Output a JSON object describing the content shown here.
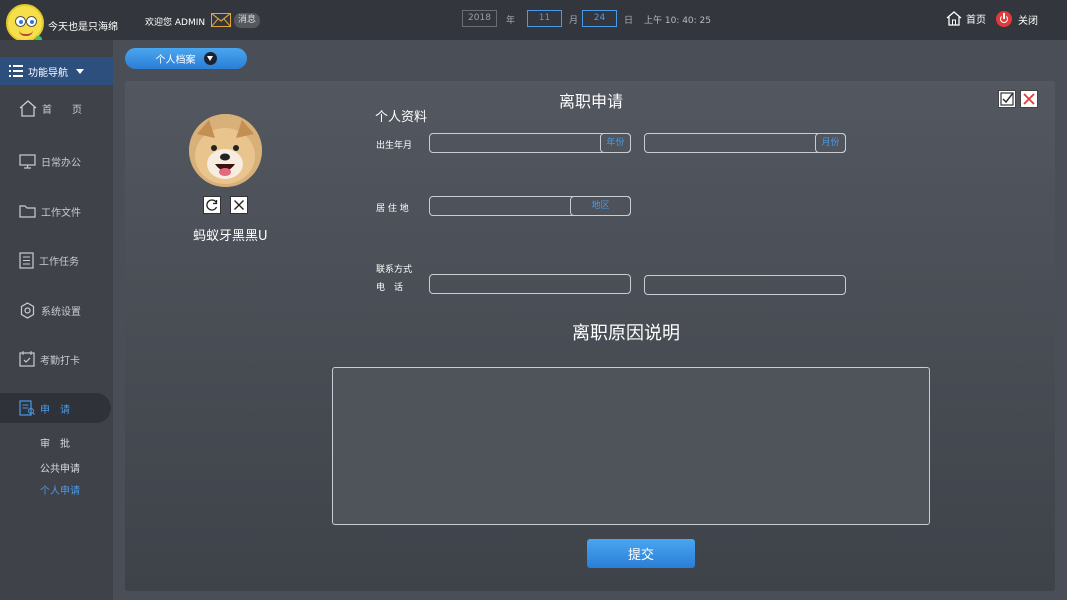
{
  "app": {
    "logo_text": "今天也是只海绵",
    "welcome": "欢迎您 ADMIN",
    "message_label": "消息"
  },
  "date": {
    "year": "2018",
    "year_unit": "年",
    "month": "11",
    "month_unit": "月",
    "day": "24",
    "day_unit": "日",
    "time": "上午 10: 40: 25"
  },
  "top_actions": {
    "home": "首页",
    "close": "关闭"
  },
  "sidebar": {
    "header": "功能导航",
    "items": [
      {
        "label": "首　　页",
        "icon": "home-icon"
      },
      {
        "label": "日常办公",
        "icon": "monitor-icon"
      },
      {
        "label": "工作文件",
        "icon": "folder-icon"
      },
      {
        "label": "工作任务",
        "icon": "task-list-icon"
      },
      {
        "label": "系统设置",
        "icon": "gear-icon"
      },
      {
        "label": "考勤打卡",
        "icon": "calendar-check-icon"
      },
      {
        "label": "申　请",
        "icon": "application-icon",
        "active": true
      }
    ],
    "sub_items": [
      {
        "label": "审　批"
      },
      {
        "label": "公共申请"
      },
      {
        "label": "个人申请",
        "active": true
      }
    ]
  },
  "tab": {
    "label": "个人档案"
  },
  "form": {
    "title": "离职申请",
    "profile_section": "个人资料",
    "username": "蚂蚁牙黑黑U",
    "birth_label": "出生年月",
    "year_suffix": "年份",
    "month_suffix": "月份",
    "residence_label": "居 住 地",
    "region_suffix": "地区",
    "contact_label": "联系方式",
    "phone_label": "电　话",
    "reason_title": "离职原因说明",
    "submit_label": "提交"
  },
  "colors": {
    "accent": "#4a9ae8",
    "sidebar_active_bg": "#2c4f7d",
    "danger": "#e23a3a"
  }
}
